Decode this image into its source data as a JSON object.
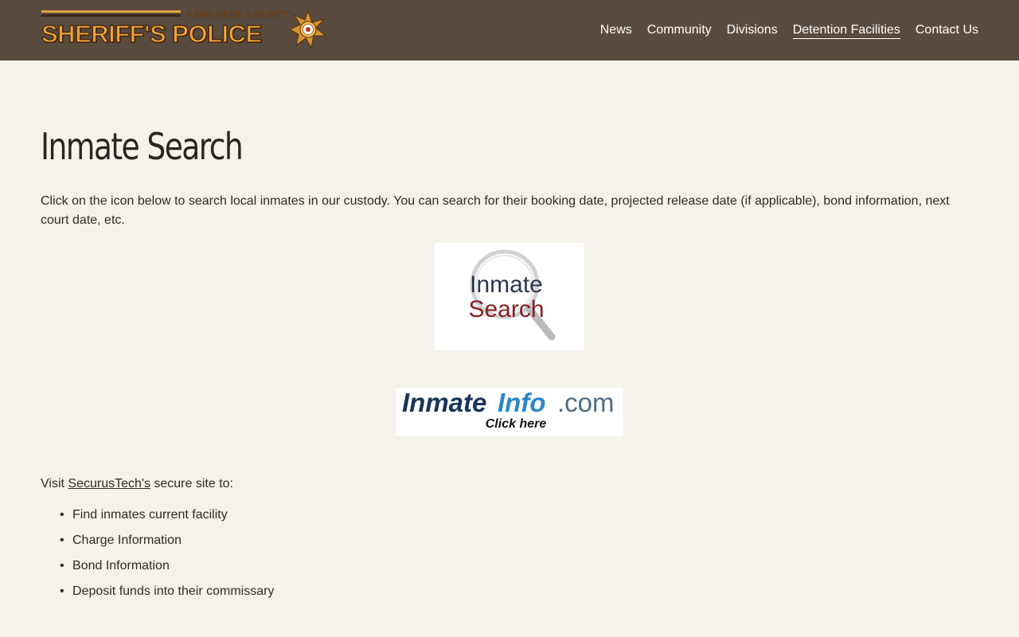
{
  "brand": {
    "county": "KANKAKEE COUNTY",
    "name": "SHERIFF'S POLICE",
    "primary_color": "#594b40",
    "logo_color": "#f2a83a"
  },
  "nav": {
    "items": [
      {
        "label": "News",
        "active": false
      },
      {
        "label": "Community",
        "active": false
      },
      {
        "label": "Divisions",
        "active": false
      },
      {
        "label": "Detention Facilities",
        "active": true
      },
      {
        "label": "Contact Us",
        "active": false
      }
    ]
  },
  "main": {
    "title": "Inmate Search",
    "intro": "Click on the icon below to search local inmates in our custody. You can search for their booking date, projected release date (if applicable), bond information, next court date, etc.",
    "inmate_search_image": {
      "line1": "Inmate",
      "line2": "Search",
      "icon": "magnifier-icon"
    },
    "inmateinfo_banner": {
      "part1": "Inmate",
      "part2": "Info",
      "part3": ".com",
      "cta": "Click here"
    },
    "visit": {
      "prefix": "Visit ",
      "link": "SecurusTech's",
      "suffix": " secure site to:"
    },
    "features": [
      "Find inmates current facility",
      "Charge Information",
      "Bond Information",
      "Deposit funds into their commissary"
    ]
  }
}
